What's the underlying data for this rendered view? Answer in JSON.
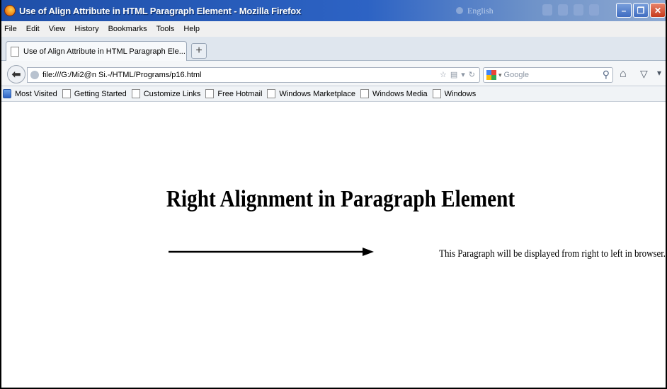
{
  "window": {
    "title": "Use of Align Attribute in HTML Paragraph Element - Mozilla Firefox",
    "language_label": "English"
  },
  "menu": [
    "File",
    "Edit",
    "View",
    "History",
    "Bookmarks",
    "Tools",
    "Help"
  ],
  "tab": {
    "label": "Use of Align Attribute in HTML Paragraph Ele..."
  },
  "nav": {
    "url": "file:///G:/Mi2@n Si.-/HTML/Programs/p16.html",
    "search_placeholder": "Google"
  },
  "bookmarks": [
    "Most Visited",
    "Getting Started",
    "Customize Links",
    "Free Hotmail",
    "Windows Marketplace",
    "Windows Media",
    "Windows"
  ],
  "content": {
    "heading": "Right Alignment in Paragraph Element",
    "paragraph": "This Paragraph will be displayed from right to left in browser."
  }
}
